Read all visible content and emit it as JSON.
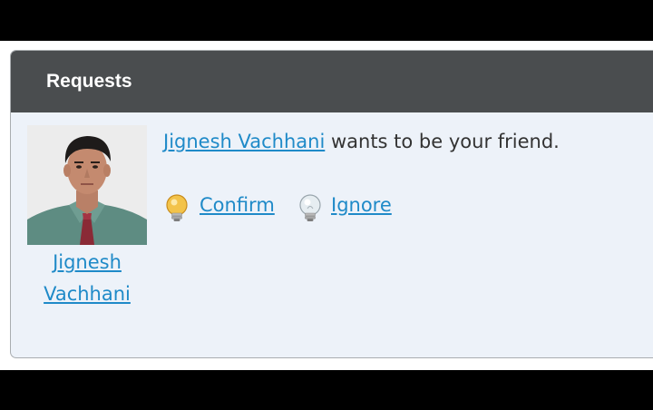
{
  "panel": {
    "title": "Requests"
  },
  "request": {
    "name": "Jignesh Vachhani",
    "name_line1": "Jignesh",
    "name_line2": "Vachhani",
    "message_suffix": " wants to be your friend.",
    "actions": {
      "confirm_label": "Confirm",
      "ignore_label": "Ignore"
    }
  },
  "icons": {
    "avatar": "profile-photo",
    "confirm": "lightbulb-on-icon",
    "ignore": "lightbulb-off-icon"
  },
  "colors": {
    "header_bg": "#4a4d4f",
    "panel_bg": "#edf2f9",
    "link": "#1f8ac8",
    "text": "#333333"
  }
}
